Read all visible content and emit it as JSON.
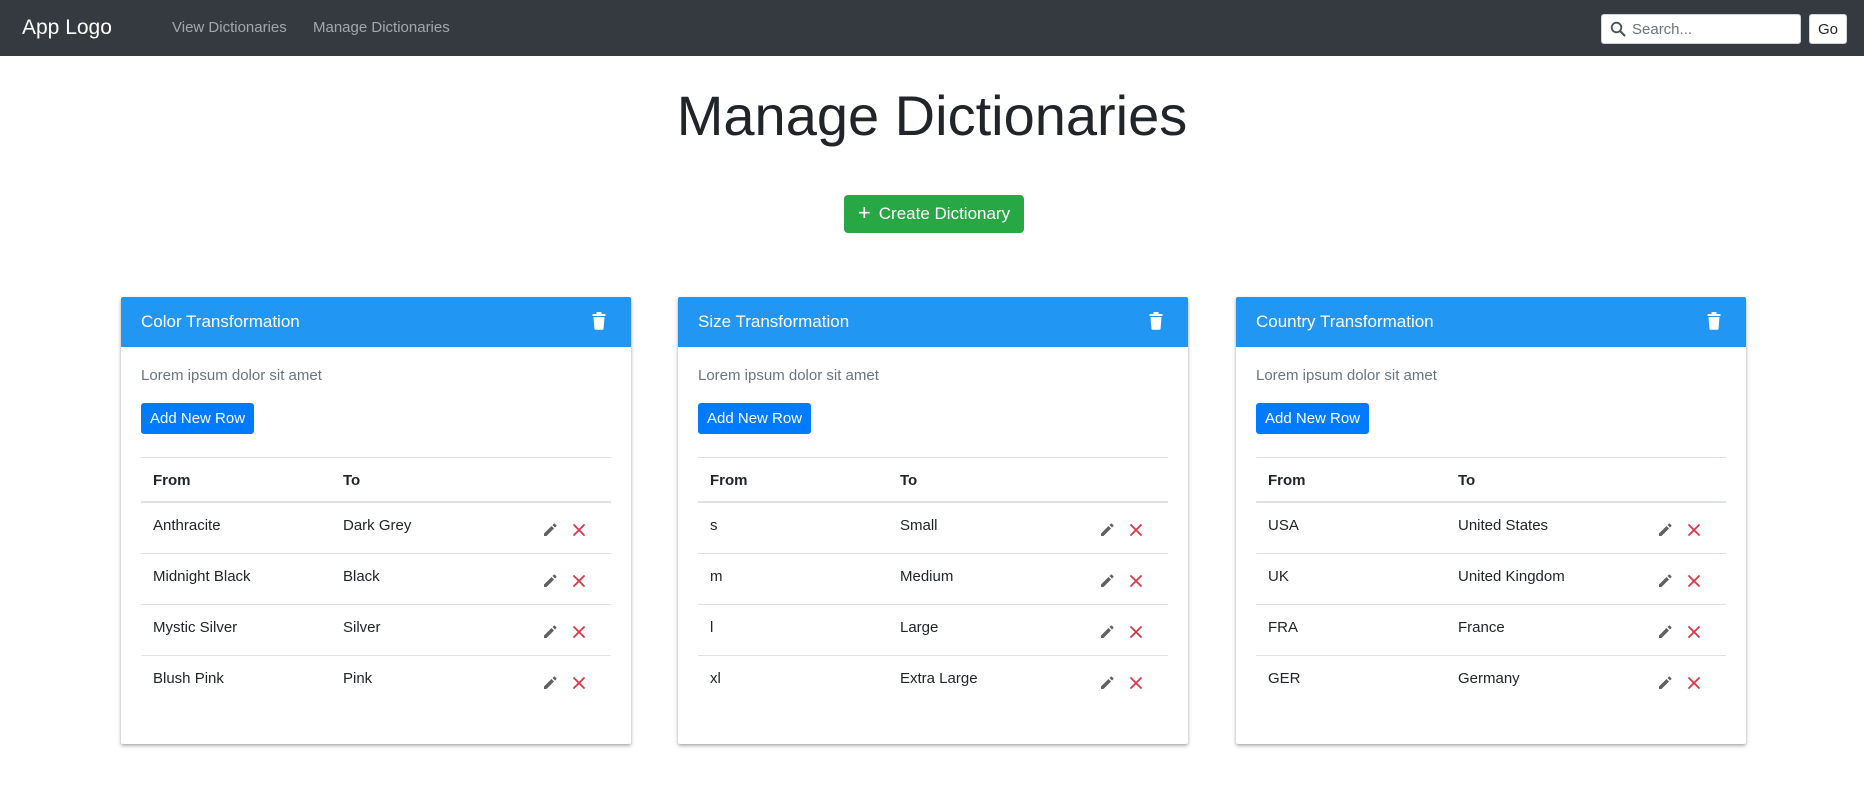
{
  "nav": {
    "brand": "App Logo",
    "links": [
      "View Dictionaries",
      "Manage Dictionaries"
    ],
    "search_placeholder": "Search...",
    "go_label": "Go"
  },
  "page": {
    "title": "Manage Dictionaries",
    "create_label": "Create Dictionary"
  },
  "colors": {
    "navbar": "#343a40",
    "card_header": "#2196f3",
    "create_button": "#28a745",
    "primary_button": "#007bff",
    "delete_icon": "#dc3545"
  },
  "cards": [
    {
      "title": "Color Transformation",
      "description": "Lorem ipsum dolor sit amet",
      "add_label": "Add New Row",
      "headers": {
        "from": "From",
        "to": "To"
      },
      "rows": [
        {
          "from": "Anthracite",
          "to": "Dark Grey"
        },
        {
          "from": "Midnight Black",
          "to": "Black"
        },
        {
          "from": "Mystic Silver",
          "to": "Silver"
        },
        {
          "from": "Blush Pink",
          "to": "Pink"
        }
      ]
    },
    {
      "title": "Size Transformation",
      "description": "Lorem ipsum dolor sit amet",
      "add_label": "Add New Row",
      "headers": {
        "from": "From",
        "to": "To"
      },
      "rows": [
        {
          "from": "s",
          "to": "Small"
        },
        {
          "from": "m",
          "to": "Medium"
        },
        {
          "from": "l",
          "to": "Large"
        },
        {
          "from": "xl",
          "to": "Extra Large"
        }
      ]
    },
    {
      "title": "Country Transformation",
      "description": "Lorem ipsum dolor sit amet",
      "add_label": "Add New Row",
      "headers": {
        "from": "From",
        "to": "To"
      },
      "rows": [
        {
          "from": "USA",
          "to": "United States"
        },
        {
          "from": "UK",
          "to": "United Kingdom"
        },
        {
          "from": "FRA",
          "to": "France"
        },
        {
          "from": "GER",
          "to": "Germany"
        }
      ]
    }
  ]
}
